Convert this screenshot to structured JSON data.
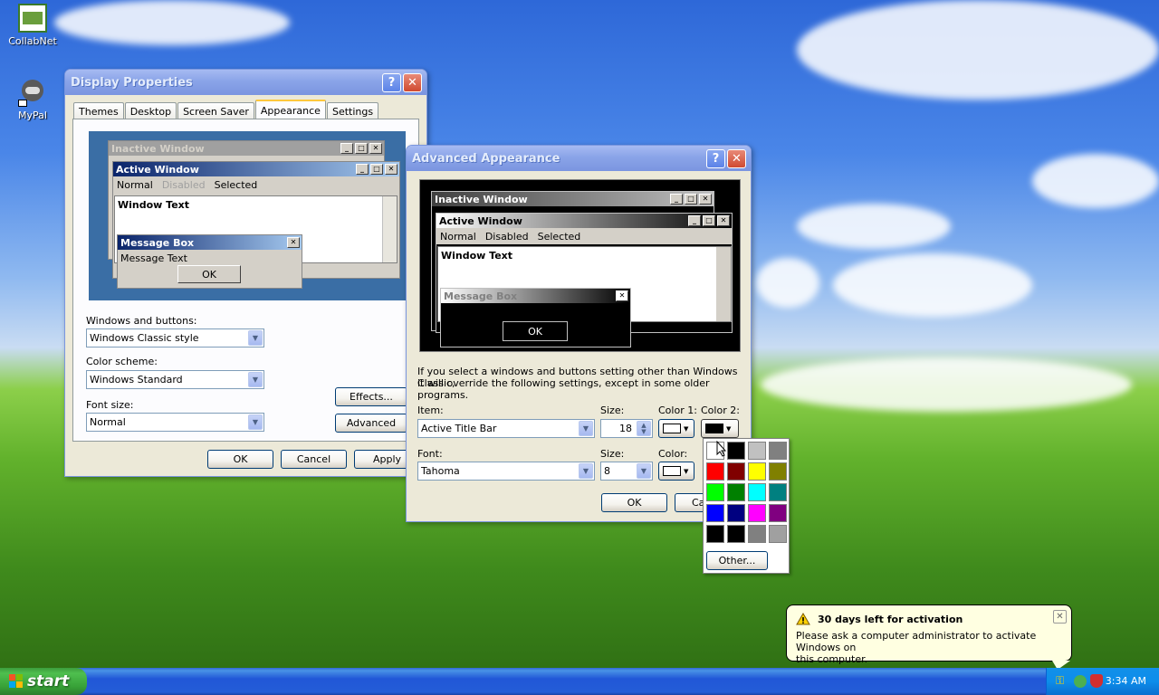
{
  "desktop": {
    "icons": [
      {
        "label": "CollabNet"
      },
      {
        "label": "MyPal"
      }
    ]
  },
  "display_properties": {
    "title": "Display Properties",
    "tabs": [
      "Themes",
      "Desktop",
      "Screen Saver",
      "Appearance",
      "Settings"
    ],
    "selected_tab": "Appearance",
    "preview": {
      "inactive_title": "Inactive Window",
      "active_title": "Active Window",
      "menu": [
        "Normal",
        "Disabled",
        "Selected"
      ],
      "window_text": "Window Text",
      "message_box_title": "Message Box",
      "message_text": "Message Text",
      "ok": "OK"
    },
    "windows_buttons_label": "Windows and buttons:",
    "windows_buttons_value": "Windows Classic style",
    "color_scheme_label": "Color scheme:",
    "color_scheme_value": "Windows Standard",
    "font_size_label": "Font size:",
    "font_size_value": "Normal",
    "effects": "Effects...",
    "advanced": "Advanced",
    "ok": "OK",
    "cancel": "Cancel",
    "apply": "Apply"
  },
  "advanced_appearance": {
    "title": "Advanced Appearance",
    "preview": {
      "inactive_title": "Inactive Window",
      "active_title": "Active Window",
      "menu": [
        "Normal",
        "Disabled",
        "Selected"
      ],
      "window_text": "Window Text",
      "message_box_title": "Message Box",
      "ok": "OK"
    },
    "info_line1": "If you select a windows and buttons setting other than Windows Classic,",
    "info_line2": "it will override the following settings, except in some older programs.",
    "item_label": "Item:",
    "item_value": "Active Title Bar",
    "size_label": "Size:",
    "size_value": "18",
    "color1_label": "Color 1:",
    "color2_label": "Color 2:",
    "font_label": "Font:",
    "font_value": "Tahoma",
    "font_size_label": "Size:",
    "font_size_value": "8",
    "font_color_label": "Color:",
    "ok": "OK",
    "cancel": "Ca"
  },
  "palette": {
    "colors": [
      "#ffffff",
      "#000000",
      "#c0c0c0",
      "#808080",
      "#ff0000",
      "#800000",
      "#ffff00",
      "#808000",
      "#00ff00",
      "#008000",
      "#00ffff",
      "#008080",
      "#0000ff",
      "#000080",
      "#ff00ff",
      "#800080",
      "#000000",
      "#000000",
      "#808080",
      "#a0a0a0"
    ],
    "other": "Other..."
  },
  "balloon": {
    "title": "30 days left for activation",
    "text_line1": "Please ask a computer administrator to activate Windows on",
    "text_line2": "this computer."
  },
  "taskbar": {
    "start": "start",
    "clock": "3:34 AM"
  }
}
